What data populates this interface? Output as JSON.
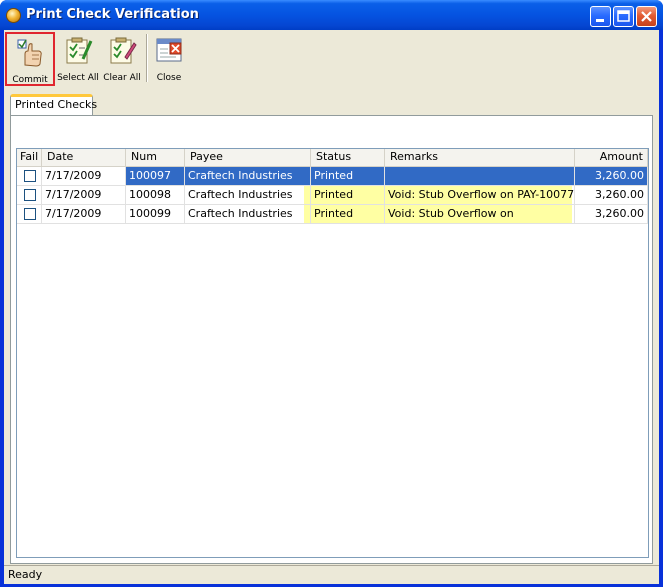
{
  "window": {
    "title": "Print Check Verification"
  },
  "toolbar": {
    "buttons": [
      {
        "label": "Commit",
        "icon": "commit-hand-icon"
      },
      {
        "label": "Select All",
        "icon": "select-all-icon"
      },
      {
        "label": "Clear All",
        "icon": "clear-all-icon"
      },
      {
        "label": "Close",
        "icon": "close-window-icon"
      }
    ]
  },
  "tabs": [
    {
      "label": "Printed Checks"
    }
  ],
  "grid": {
    "columns": [
      "Fail",
      "Date",
      "Num",
      "Payee",
      "Status",
      "Remarks",
      "Amount"
    ],
    "rows": [
      {
        "fail": false,
        "date": "7/17/2009",
        "num": "100097",
        "payee": "Craftech Industries",
        "status": "Printed",
        "remarks": "",
        "amount": "3,260.00",
        "selected": true
      },
      {
        "fail": false,
        "date": "7/17/2009",
        "num": "100098",
        "payee": "Craftech Industries",
        "status": "Printed",
        "remarks": "Void: Stub Overflow on PAY-10077",
        "amount": "3,260.00",
        "selected": false
      },
      {
        "fail": false,
        "date": "7/17/2009",
        "num": "100099",
        "payee": "Craftech Industries",
        "status": "Printed",
        "remarks": "Void: Stub Overflow on",
        "amount": "3,260.00",
        "selected": false
      }
    ]
  },
  "status": {
    "text": "Ready"
  },
  "colors": {
    "titlebar": "#0553E1",
    "selection": "#316AC5",
    "highlight": "#FFFF66",
    "callout": "#E0262F"
  }
}
